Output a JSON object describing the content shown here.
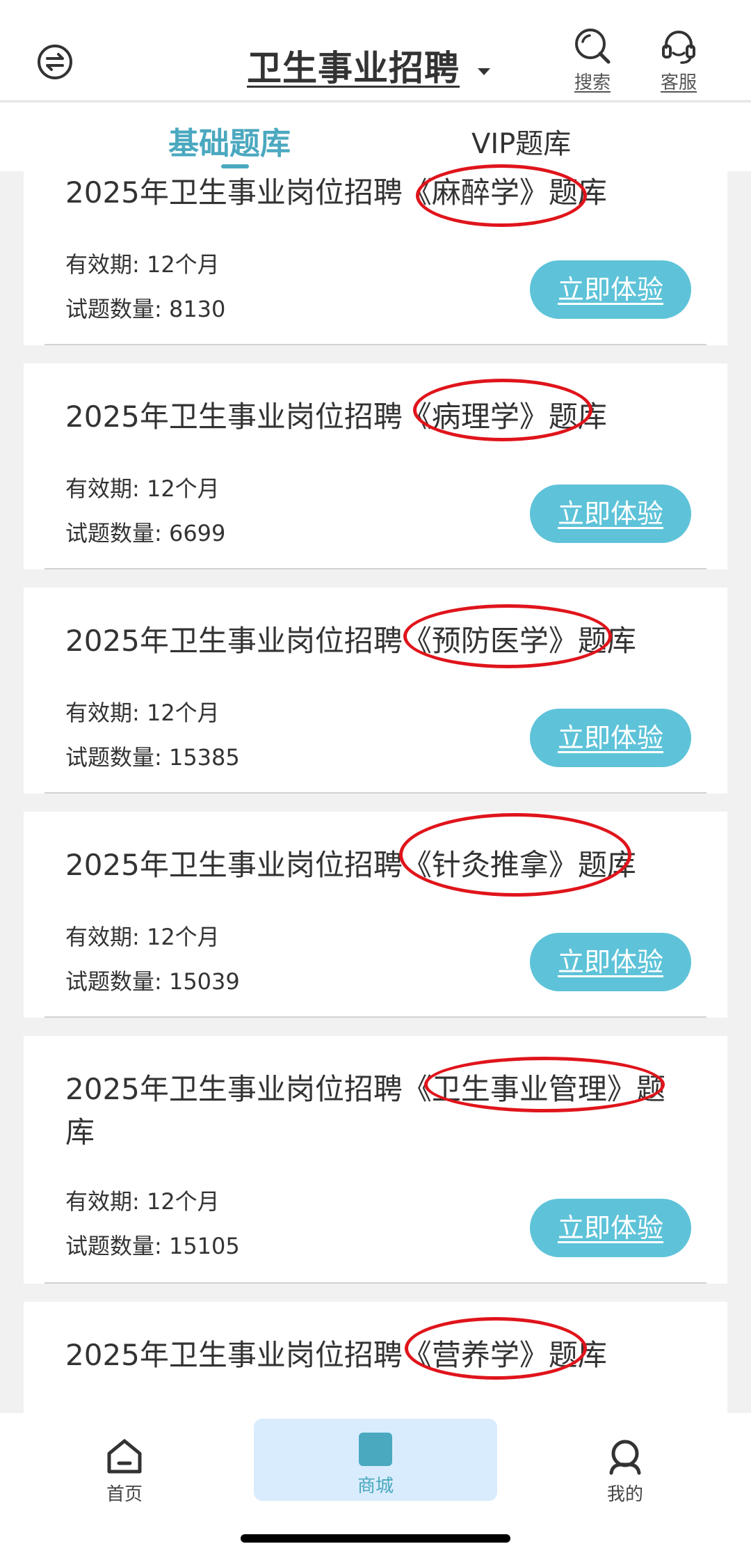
{
  "header": {
    "title": "卫生事业招聘",
    "search_label": "搜索",
    "service_label": "客服"
  },
  "tabs": [
    {
      "label": "基础题库",
      "active": true
    },
    {
      "label": "VIP题库",
      "active": false
    }
  ],
  "cards": [
    {
      "title": "2025年卫生事业岗位招聘《麻醉学》题库",
      "validity": "有效期: 12个月",
      "count": "试题数量: 8130",
      "button": "立即体验"
    },
    {
      "title": "2025年卫生事业岗位招聘《病理学》题库",
      "validity": "有效期: 12个月",
      "count": "试题数量: 6699",
      "button": "立即体验"
    },
    {
      "title": "2025年卫生事业岗位招聘《预防医学》题库",
      "validity": "有效期: 12个月",
      "count": "试题数量: 15385",
      "button": "立即体验"
    },
    {
      "title": "2025年卫生事业岗位招聘《针灸推拿》题库",
      "validity": "有效期: 12个月",
      "count": "试题数量: 15039",
      "button": "立即体验"
    },
    {
      "title": "2025年卫生事业岗位招聘《卫生事业管理》题库",
      "validity": "有效期: 12个月",
      "count": "试题数量: 15105",
      "button": "立即体验"
    },
    {
      "title": "2025年卫生事业岗位招聘《营养学》题库"
    }
  ],
  "bottom_nav": [
    {
      "label": "首页",
      "icon": "home-icon",
      "active": false
    },
    {
      "label": "商城",
      "icon": "shop-icon",
      "active": true
    },
    {
      "label": "我的",
      "icon": "user-icon",
      "active": false
    }
  ],
  "colors": {
    "accent": "#4aa8bf",
    "button": "#5ec3d9",
    "annotation": "#e0141b",
    "active_nav_bg": "#d9ecfd"
  }
}
